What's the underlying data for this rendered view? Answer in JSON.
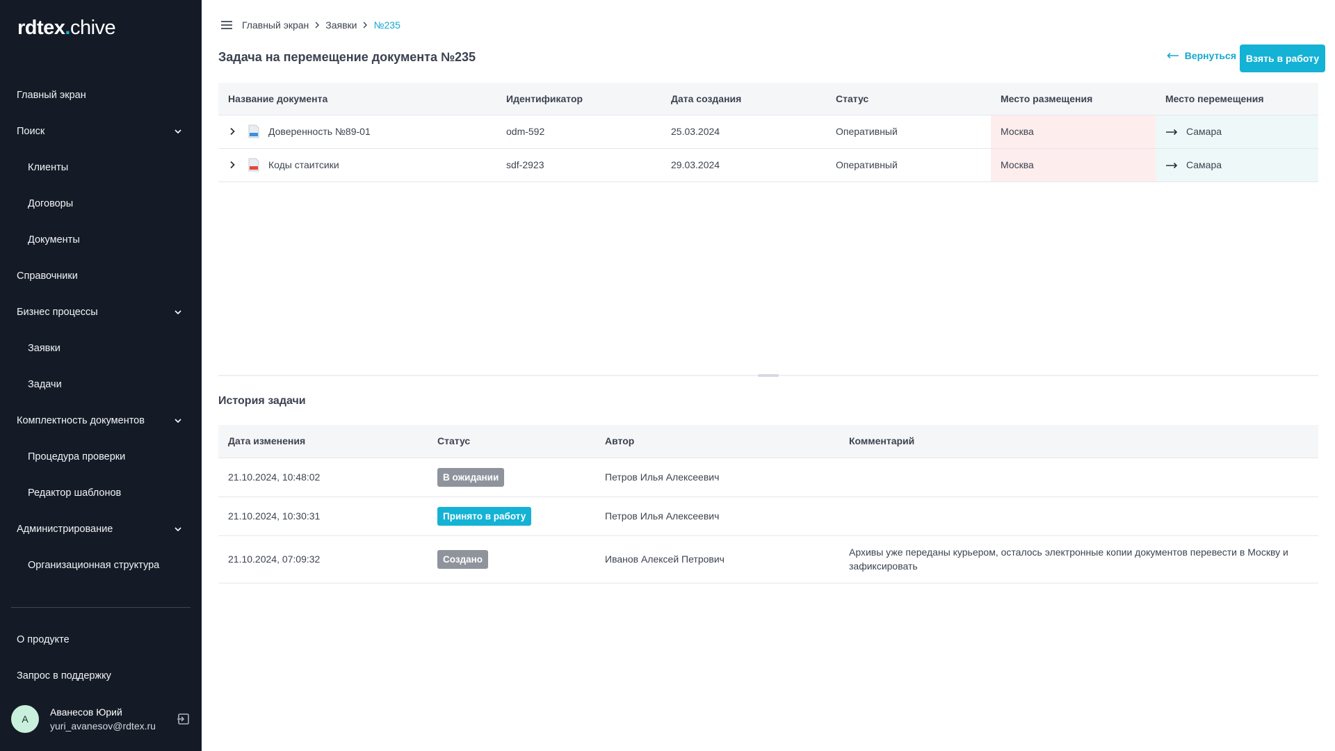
{
  "sidebar": {
    "logo": {
      "part1": "rdtex",
      "dot": ".",
      "part2": "chive"
    },
    "items": [
      {
        "label": "Главный экран",
        "sub": false,
        "chevron": false
      },
      {
        "label": "Поиск",
        "sub": false,
        "chevron": true
      },
      {
        "label": "Клиенты",
        "sub": true,
        "chevron": false
      },
      {
        "label": "Договоры",
        "sub": true,
        "chevron": false
      },
      {
        "label": "Документы",
        "sub": true,
        "chevron": false
      },
      {
        "label": "Справочники",
        "sub": false,
        "chevron": false
      },
      {
        "label": "Бизнес процессы",
        "sub": false,
        "chevron": true
      },
      {
        "label": "Заявки",
        "sub": true,
        "chevron": false
      },
      {
        "label": "Задачи",
        "sub": true,
        "chevron": false
      },
      {
        "label": "Комплектность документов",
        "sub": false,
        "chevron": true
      },
      {
        "label": "Процедура проверки",
        "sub": true,
        "chevron": false
      },
      {
        "label": "Редактор шаблонов",
        "sub": true,
        "chevron": false
      },
      {
        "label": "Администрирование",
        "sub": false,
        "chevron": true
      },
      {
        "label": "Организационная структура",
        "sub": true,
        "chevron": false
      }
    ],
    "bottom_items": [
      {
        "label": "О продукте"
      },
      {
        "label": "Запрос в поддержку"
      }
    ],
    "user": {
      "initial": "А",
      "name": "Аванесов Юрий",
      "email": "yuri_avanesov@rdtex.ru"
    }
  },
  "breadcrumb": {
    "items": [
      "Главный экран",
      "Заявки",
      "№235"
    ]
  },
  "page": {
    "title": "Задача на перемещение документа №235",
    "back_label": "Вернуться",
    "take_label": "Взять в работу"
  },
  "documents": {
    "columns": [
      "Название документа",
      "Идентификатор",
      "Дата создания",
      "Статус",
      "Место размещения",
      "Место перемещения"
    ],
    "rows": [
      {
        "name": "Доверенность №89-01",
        "file_type": "doc",
        "id": "odm-592",
        "created": "25.03.2024",
        "status": "Оперативный",
        "location": "Москва",
        "destination": "Самара"
      },
      {
        "name": "Коды стаитсики",
        "file_type": "pdf",
        "id": "sdf-2923",
        "created": "29.03.2024",
        "status": "Оперативный",
        "location": "Москва",
        "destination": "Самара"
      }
    ]
  },
  "history": {
    "title": "История задачи",
    "columns": [
      "Дата изменения",
      "Статус",
      "Автор",
      "Комментарий"
    ],
    "rows": [
      {
        "date": "21.10.2024, 10:48:02",
        "status": "В ожидании",
        "status_color": "#8e939c",
        "author": "Петров Илья Алексеевич",
        "comment": ""
      },
      {
        "date": "21.10.2024, 10:30:31",
        "status": "Принято в работу",
        "status_color": "#14b2d4",
        "author": "Петров Илья Алексеевич",
        "comment": ""
      },
      {
        "date": "21.10.2024, 07:09:32",
        "status": "Создано",
        "status_color": "#8e939c",
        "author": "Иванов Алексей Петрович",
        "comment": "Архивы уже переданы курьером, осталось электронные копии документов перевести в Москву и зафиксировать"
      }
    ]
  },
  "colors": {
    "sidebar_bg": "#151b26",
    "accent": "#14b2d4",
    "place_bg": "#fdeeed",
    "move_bg": "#eef8f9"
  },
  "icons": [
    "menu-icon",
    "chevron-right-icon",
    "chevron-down-icon",
    "arrow-left-icon",
    "arrow-right-icon",
    "doc-file-icon",
    "pdf-file-icon",
    "logout-icon"
  ]
}
